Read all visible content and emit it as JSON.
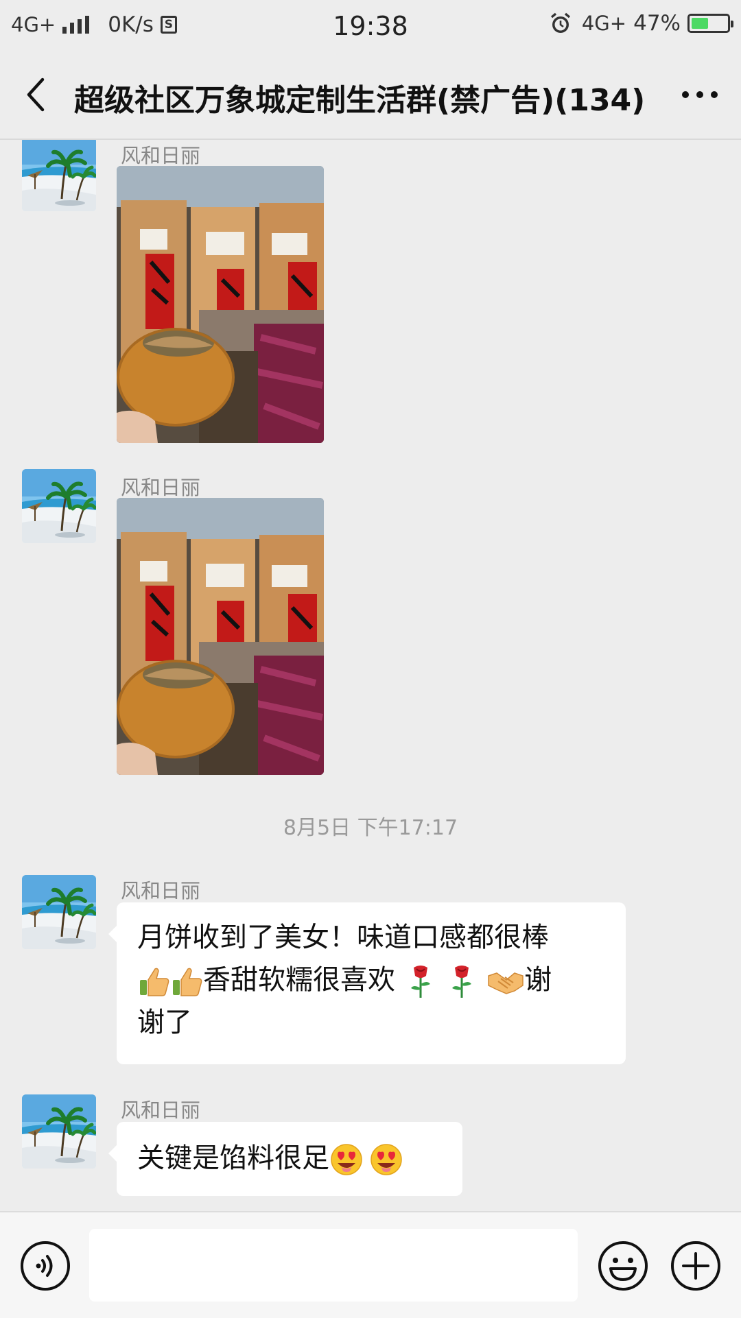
{
  "status_bar": {
    "network": "4G+",
    "speed": "0K/s",
    "time": "19:38",
    "network_right": "4G+",
    "battery_percent": "47%",
    "battery_level": 0.47
  },
  "header": {
    "title": "超级社区万象城定制生活群(禁广告)(134)"
  },
  "messages": [
    {
      "type": "image",
      "sender": "风和日丽",
      "image": "mooncake-bags-photo"
    },
    {
      "type": "image",
      "sender": "风和日丽",
      "image": "mooncake-bags-photo"
    },
    {
      "type": "timestamp",
      "text": "8月5日 下午17:17"
    },
    {
      "type": "text",
      "sender": "风和日丽",
      "line1": "月饼收到了美女！味道口感都很棒",
      "line2_text": "香甜软糯很喜欢",
      "line2_tail": "谢",
      "line3": "谢了",
      "emojis": [
        "thumbs-up-icon",
        "thumbs-up-icon",
        "rose-icon",
        "rose-icon",
        "handshake-icon"
      ]
    },
    {
      "type": "text",
      "sender": "风和日丽",
      "line1": "关键是馅料很足",
      "emojis": [
        "heart-eyes-icon",
        "heart-eyes-icon"
      ]
    }
  ],
  "input_bar": {
    "placeholder": "",
    "icons": [
      "voice-icon",
      "emoji-icon",
      "plus-icon"
    ]
  },
  "colors": {
    "background": "#ededed",
    "bubble": "#ffffff",
    "timestamp": "#9a9a9a",
    "sender": "#888888"
  }
}
